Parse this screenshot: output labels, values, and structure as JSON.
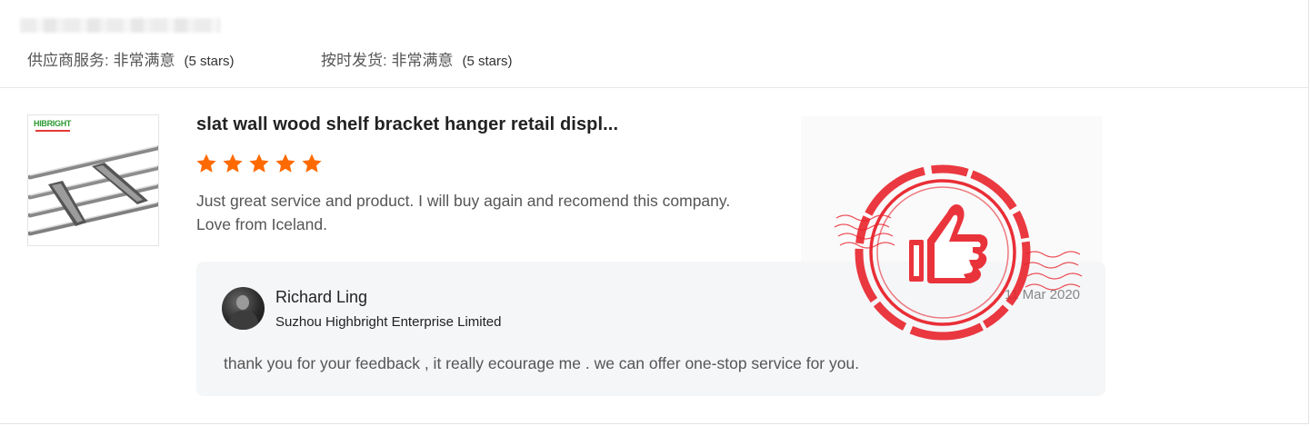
{
  "header": {
    "ratings": [
      {
        "label": "供应商服务: 非常满意",
        "note": "(5 stars)"
      },
      {
        "label": "按时发货: 非常满意",
        "note": "(5 stars)"
      }
    ]
  },
  "review": {
    "thumbnail": {
      "brand": "HIBRIGHT",
      "icon": "product-photo"
    },
    "product_title": "slat wall wood shelf bracket hanger retail displ...",
    "rating": 5,
    "text_line1": "Just great service and product.  I will buy again and recomend this company.",
    "text_line2": "Love from Iceland.",
    "stamp_icon": "thumbs-up-stamp-icon"
  },
  "reply": {
    "author": "Richard Ling",
    "company": "Suzhou Highbright Enterprise Limited",
    "date": "11 Mar 2020",
    "text": "thank you for your feedback , it really ecourage me . we can offer one-stop service for you."
  },
  "colors": {
    "star": "#ff6a00",
    "stamp": "#e8232b",
    "reply_bg": "#f5f6f8"
  }
}
